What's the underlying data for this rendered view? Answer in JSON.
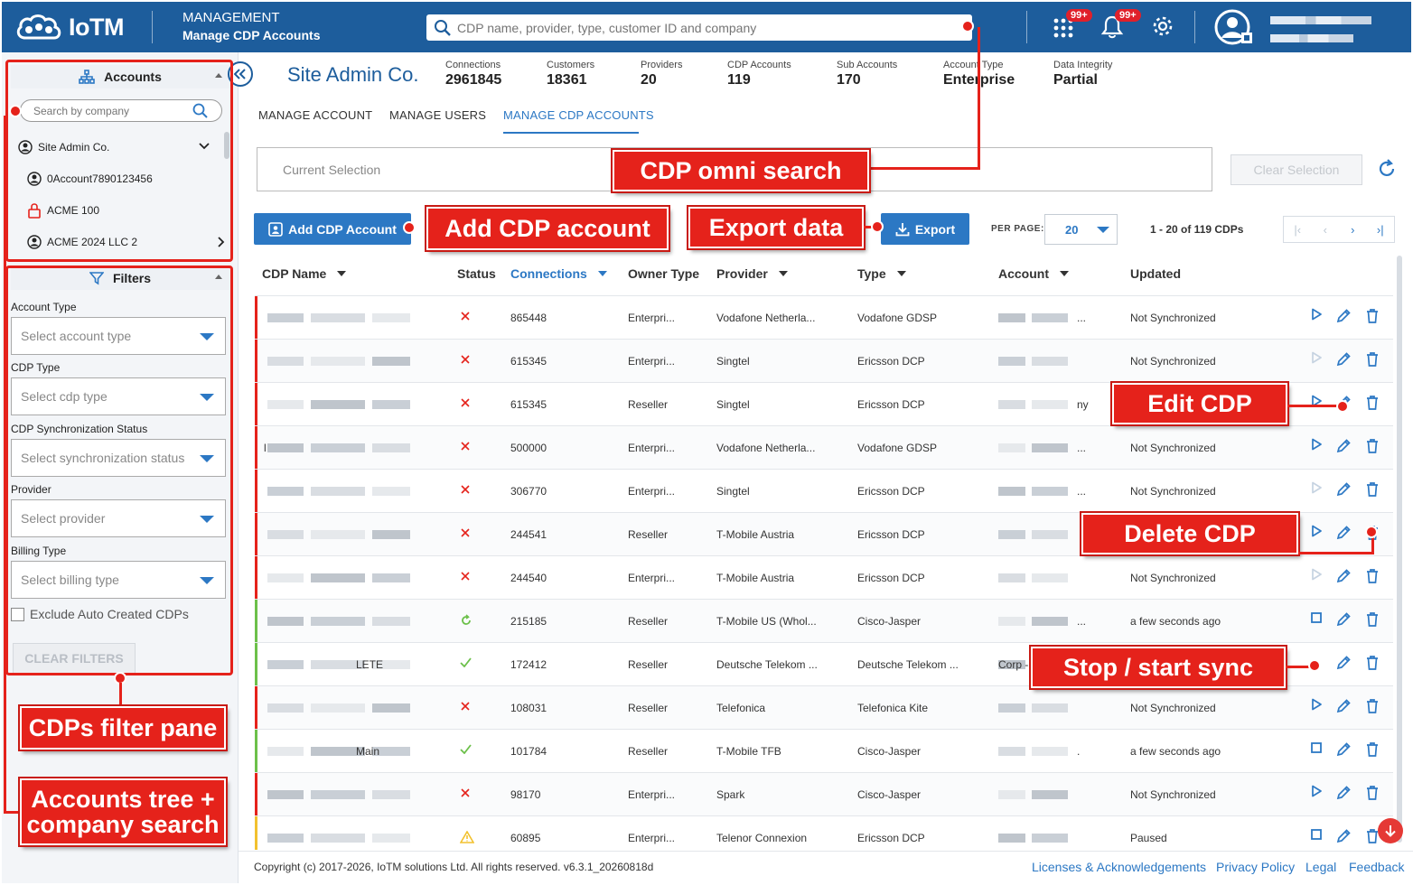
{
  "header": {
    "logo_text": "IoTM",
    "section": "MANAGEMENT",
    "subtitle": "Manage CDP Accounts",
    "search_placeholder": "CDP name, provider, type, customer ID and company",
    "apps_badge": "99+",
    "notifications_badge": "99+"
  },
  "sidebar": {
    "accounts_title": "Accounts",
    "company_search_placeholder": "Search by company",
    "tree": [
      "Site Admin Co.",
      "0Account7890123456",
      "ACME 100",
      "ACME 2024 LLC 2"
    ],
    "filters_title": "Filters",
    "filters": [
      {
        "label": "Account Type",
        "placeholder": "Select account type"
      },
      {
        "label": "CDP Type",
        "placeholder": "Select cdp type"
      },
      {
        "label": "CDP Synchronization Status",
        "placeholder": "Select synchronization status"
      },
      {
        "label": "Provider",
        "placeholder": "Select provider"
      },
      {
        "label": "Billing Type",
        "placeholder": "Select billing type"
      }
    ],
    "exclude_label": "Exclude Auto Created CDPs",
    "clear_filters": "CLEAR FILTERS"
  },
  "account": {
    "name": "Site Admin Co.",
    "stats": [
      {
        "label": "Connections",
        "value": "2961845"
      },
      {
        "label": "Customers",
        "value": "18361"
      },
      {
        "label": "Providers",
        "value": "20"
      },
      {
        "label": "CDP Accounts",
        "value": "119"
      },
      {
        "label": "Sub Accounts",
        "value": "170"
      },
      {
        "label": "Account Type",
        "value": "Enterprise"
      },
      {
        "label": "Data Integrity",
        "value": "Partial"
      }
    ]
  },
  "tabs": [
    "MANAGE ACCOUNT",
    "MANAGE USERS",
    "MANAGE CDP ACCOUNTS"
  ],
  "active_tab": "MANAGE CDP ACCOUNTS",
  "toolbar": {
    "current_selection": "Current Selection",
    "clear_selection": "Clear Selection",
    "add_cdp": "Add CDP Account",
    "export": "Export",
    "per_page_label": "PER PAGE:",
    "per_page": "20",
    "pager_info": "1 - 20 of 119 CDPs"
  },
  "table": {
    "columns": [
      "CDP Name",
      "Status",
      "Connections",
      "Owner Type",
      "Provider",
      "Type",
      "Account",
      "Updated"
    ],
    "rows": [
      {
        "name": "",
        "status": "error",
        "connections": "865448",
        "owner": "Enterpri...",
        "provider": "Vodafone Netherla...",
        "type": "Vodafone GDSP",
        "account": "...",
        "updated": "Not Synchronized",
        "action": "start",
        "bar": "#e5221b"
      },
      {
        "name": "",
        "status": "error",
        "connections": "615345",
        "owner": "Enterpri...",
        "provider": "Singtel",
        "type": "Ericsson DCP",
        "account": "",
        "updated": "Not Synchronized",
        "action": "start-disabled",
        "bar": "#e5221b"
      },
      {
        "name": "",
        "status": "error",
        "connections": "615345",
        "owner": "Reseller",
        "provider": "Singtel",
        "type": "Ericsson DCP",
        "account": "ny",
        "updated": "",
        "action": "start",
        "bar": "#e5221b"
      },
      {
        "name": "l",
        "status": "error",
        "connections": "500000",
        "owner": "Enterpri...",
        "provider": "Vodafone Netherla...",
        "type": "Vodafone GDSP",
        "account": "...",
        "updated": "Not Synchronized",
        "action": "start",
        "bar": "#e5221b"
      },
      {
        "name": "",
        "status": "error",
        "connections": "306770",
        "owner": "Enterpri...",
        "provider": "Singtel",
        "type": "Ericsson DCP",
        "account": "...",
        "updated": "Not Synchronized",
        "action": "start-disabled",
        "bar": "#e5221b"
      },
      {
        "name": "",
        "status": "error",
        "connections": "244541",
        "owner": "Reseller",
        "provider": "T-Mobile Austria",
        "type": "Ericsson DCP",
        "account": "",
        "updated": "",
        "action": "start",
        "bar": "#e5221b"
      },
      {
        "name": "",
        "status": "error",
        "connections": "244540",
        "owner": "Enterpri...",
        "provider": "T-Mobile Austria",
        "type": "Ericsson DCP",
        "account": "",
        "updated": "Not Synchronized",
        "action": "start-disabled",
        "bar": "#e5221b"
      },
      {
        "name": "",
        "status": "sync",
        "connections": "215185",
        "owner": "Reseller",
        "provider": "T-Mobile US (Whol...",
        "type": "Cisco-Jasper",
        "account": "...",
        "updated": "a few seconds ago",
        "action": "stop",
        "bar": "#6cc04a"
      },
      {
        "name": "LETE",
        "status": "ok",
        "connections": "172412",
        "owner": "Reseller",
        "provider": "Deutsche Telekom ...",
        "type": "Deutsche Telekom ...",
        "account": "Corp -",
        "updated": "",
        "action": "none",
        "bar": "#6cc04a"
      },
      {
        "name": "",
        "status": "error",
        "connections": "108031",
        "owner": "Reseller",
        "provider": "Telefonica",
        "type": "Telefonica Kite",
        "account": "",
        "updated": "Not Synchronized",
        "action": "start",
        "bar": "#e5221b"
      },
      {
        "name": "Main",
        "status": "ok",
        "connections": "101784",
        "owner": "Reseller",
        "provider": "T-Mobile TFB",
        "type": "Cisco-Jasper",
        "account": ".",
        "updated": "a few seconds ago",
        "action": "stop",
        "bar": "#6cc04a"
      },
      {
        "name": "",
        "status": "error",
        "connections": "98170",
        "owner": "Enterpri...",
        "provider": "Spark",
        "type": "Cisco-Jasper",
        "account": "",
        "updated": "Not Synchronized",
        "action": "start",
        "bar": "#e5221b"
      },
      {
        "name": "",
        "status": "warning",
        "connections": "60895",
        "owner": "Enterpri...",
        "provider": "Telenor Connexion",
        "type": "Ericsson DCP",
        "account": "",
        "updated": "Paused",
        "action": "stop",
        "bar": "#f2c12e"
      }
    ]
  },
  "footer": {
    "copyright": "Copyright (c) 2017-2026, IoTM solutions Ltd. All rights reserved. v6.3.1_20260818d",
    "links": [
      "Licenses & Acknowledgements",
      "Privacy Policy",
      "Legal",
      "Feedback"
    ]
  },
  "callouts": {
    "omni": "CDP omni search",
    "add": "Add CDP account",
    "export": "Export data",
    "edit": "Edit CDP",
    "delete": "Delete CDP",
    "sync": "Stop / start sync",
    "filter": "CDPs filter pane",
    "tree_line1": "Accounts tree +",
    "tree_line2": "company search"
  },
  "colors": {
    "primary": "#1d5d9c",
    "accent": "#2c78c4",
    "callout": "#e5221b",
    "ok": "#6cc04a",
    "warning": "#f2c12e"
  }
}
